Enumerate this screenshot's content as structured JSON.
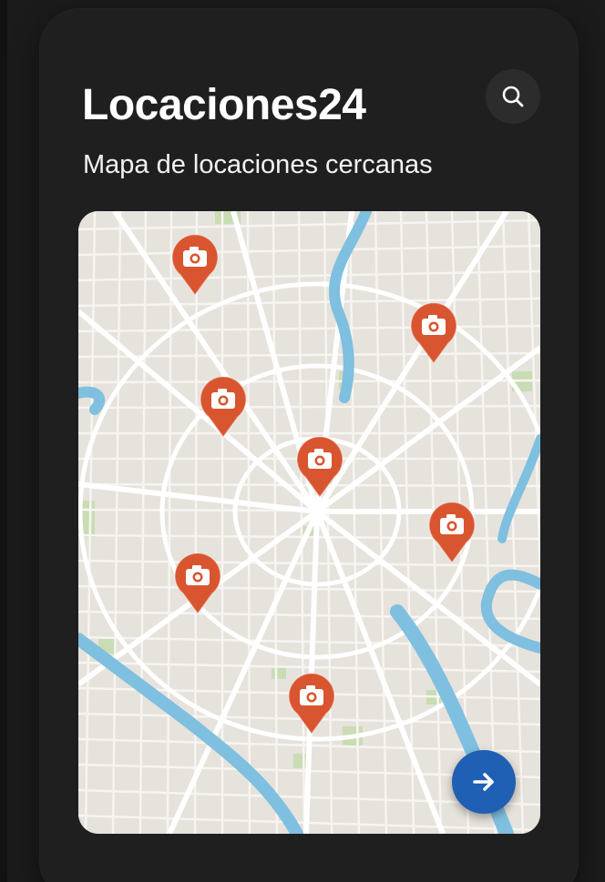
{
  "app": {
    "title": "Locaciones24",
    "subtitle": "Mapa de locaciones cercanas"
  },
  "header": {
    "search_icon": "search-icon"
  },
  "map": {
    "pin_icon": "camera-pin-icon",
    "pin_count": 7,
    "colors": {
      "land": "#e6e2dc",
      "roads": "#ffffff",
      "water": "#7fbfe0",
      "parks": "#c9dcb4",
      "pin": "#d9552f"
    }
  },
  "actions": {
    "next_icon": "arrow-right-icon",
    "next_color": "#1f5fb4"
  }
}
